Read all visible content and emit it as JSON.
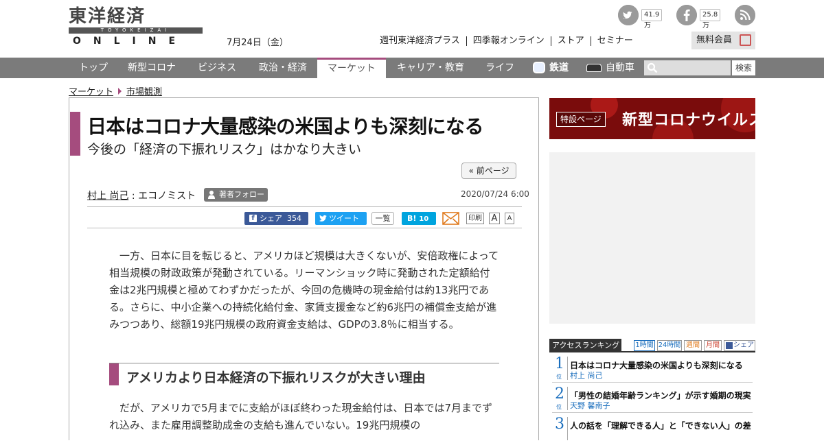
{
  "header": {
    "logo_kanji": "東洋経済",
    "logo_roman": "TOYOKEIZAI",
    "logo_online": "ONLINE",
    "date": "7月24日（金）",
    "twitter_count": "41.9万",
    "facebook_count": "25.8万",
    "top_links": [
      "週刊東洋経済プラス",
      "四季報オンライン",
      "ストア",
      "セミナー"
    ],
    "member_label": "無料会員"
  },
  "nav": {
    "items": [
      "トップ",
      "新型コロナ",
      "ビジネス",
      "政治・経済",
      "マーケット",
      "キャリア・教育",
      "ライフ",
      "鉄道",
      "自動車"
    ],
    "active": "マーケット",
    "search_button": "検索"
  },
  "breadcrumb": [
    "マーケット",
    "市場観測"
  ],
  "article": {
    "title": "日本はコロナ大量感染の米国よりも深刻になる",
    "subtitle": "今後の「経済の下振れリスク」はかなり大きい",
    "prev_page": "« 前ページ",
    "author": "村上 尚己",
    "author_role": " : エコノミスト",
    "follow": "著者フォロー",
    "date": "2020/07/24 6:00",
    "share": {
      "fb_label": "シェア",
      "fb_count": "354",
      "tweet_label": "ツイート",
      "list_label": "一覧",
      "hatena_label": "B!",
      "hatena_count": "10",
      "print_label": "印刷",
      "font_large": "A",
      "font_small": "A"
    },
    "paragraph1": "　一方、日本に目を転じると、アメリカほど規模は大きくないが、安倍政権によって相当規模の財政政策が発動されている。リーマンショック時に発動された定額給付金は2兆円規模と極めてわずかだったが、今回の危機時の現金給付は約13兆円である。さらに、中小企業への持続化給付金、家賃支援金など約6兆円の補償金支給が進みつつあり、総額19兆円規模の政府資金支給は、GDPの3.8％に相当する。",
    "heading": "アメリカより日本経済の下振れリスクが大きい理由",
    "paragraph2": "　だが、アメリカで5月までに支給がほぼ終わった現金給付は、日本では7月までずれ込み、また雇用調整助成金の支給も進んでいない。19兆円規模の"
  },
  "sidebar": {
    "banner_tag": "特設ページ",
    "banner_title": "新型コロナウイルス",
    "ranking_label": "アクセスランキング",
    "ranking_tabs": [
      "1時間",
      "24時間",
      "週間",
      "月間",
      "シェア"
    ],
    "ranking_pos_label": "位",
    "ranking": [
      {
        "rank": "1",
        "title": "日本はコロナ大量感染の米国よりも深刻になる",
        "author": "村上 尚己"
      },
      {
        "rank": "2",
        "title": "「男性の結婚年齢ランキング」が示す婚期の現実",
        "author": "天野 馨南子"
      },
      {
        "rank": "3",
        "title": "人の話を「理解できる人」と「できない人」の差",
        "author": ""
      }
    ]
  },
  "colors": {
    "accent": "#a54c7e",
    "nav_bg": "#7b7b7b",
    "facebook": "#3b5998",
    "twitter": "#1da1f2",
    "hatena": "#00a4de",
    "rank_blue": "#1a6ebd"
  }
}
